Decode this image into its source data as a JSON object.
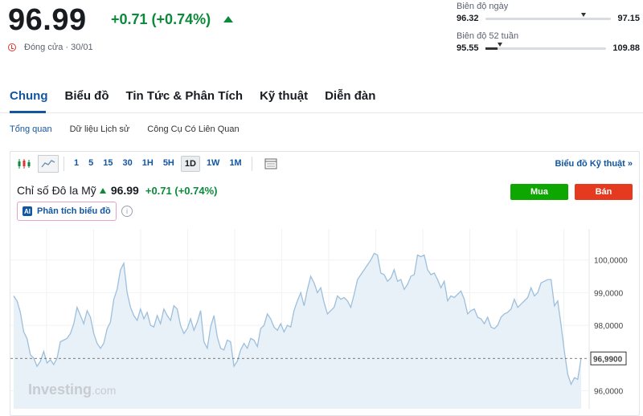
{
  "quote": {
    "price": "96.99",
    "change": "+0.71 (+0.74%)",
    "status": "Đóng cửa · 30/01"
  },
  "day_range": {
    "label": "Biên độ ngày",
    "low": "96.32",
    "high": "97.15",
    "position": 0.76
  },
  "range_52w": {
    "label": "Biên độ 52 tuần",
    "low": "95.55",
    "high": "109.88",
    "position": 0.1
  },
  "tabs": [
    {
      "label": "Chung",
      "active": true
    },
    {
      "label": "Biểu đồ",
      "active": false
    },
    {
      "label": "Tin Tức & Phân Tích",
      "active": false
    },
    {
      "label": "Kỹ thuật",
      "active": false
    },
    {
      "label": "Diễn đàn",
      "active": false
    }
  ],
  "subtabs": [
    {
      "label": "Tổng quan",
      "active": true
    },
    {
      "label": "Dữ liệu Lịch sử",
      "active": false
    },
    {
      "label": "Công Cụ Có Liên Quan",
      "active": false
    }
  ],
  "toolbar": {
    "timeframes": [
      "1",
      "5",
      "15",
      "30",
      "1H",
      "5H",
      "1D",
      "1W",
      "1M"
    ],
    "active_timeframe": "1D",
    "tech_link": "Biểu đồ Kỹ thuật »"
  },
  "chart_header": {
    "name": "Chỉ số Đô la Mỹ",
    "value": "96.99",
    "change": "+0.71 (+0.74%)",
    "ai_label": "Phân tích biểu đồ",
    "ai_badge": "AI",
    "info": "i"
  },
  "trade": {
    "buy": "Mua",
    "sell": "Bán"
  },
  "colors": {
    "up": "#0a8a3a",
    "accent": "#1256a0",
    "buy": "#0ea600",
    "sell": "#e53a20",
    "line": "#9dbfdc",
    "area": "#e8f1f8"
  },
  "watermark": {
    "brand": "Investing",
    "suffix": ".com"
  },
  "chart_data": {
    "type": "area",
    "y_ticks": [
      "100,0000",
      "99,0000",
      "98,0000",
      "96,0000"
    ],
    "y_tick_values": [
      100,
      99,
      98,
      96
    ],
    "current_label": "96,9900",
    "current_value": 96.99,
    "ylim": [
      95.45,
      100.95
    ],
    "values": [
      98.9,
      98.75,
      98.4,
      97.8,
      97.6,
      97.1,
      97.0,
      96.75,
      96.9,
      97.2,
      96.85,
      96.95,
      96.8,
      97.0,
      97.5,
      97.55,
      97.6,
      97.75,
      98.05,
      98.55,
      98.3,
      98.05,
      98.45,
      98.25,
      97.75,
      97.45,
      97.3,
      97.45,
      97.9,
      98.1,
      98.8,
      99.1,
      99.7,
      99.9,
      99.0,
      98.55,
      98.3,
      98.15,
      98.5,
      98.2,
      98.4,
      98.0,
      97.95,
      98.3,
      98.05,
      98.5,
      98.3,
      98.15,
      98.6,
      98.5,
      98.0,
      97.75,
      97.9,
      98.2,
      97.85,
      98.1,
      98.45,
      97.5,
      97.3,
      97.95,
      98.3,
      97.65,
      97.3,
      97.25,
      97.55,
      97.5,
      96.75,
      96.9,
      97.25,
      97.45,
      97.3,
      97.6,
      97.55,
      97.35,
      97.9,
      98.0,
      98.35,
      98.2,
      97.95,
      97.85,
      98.05,
      97.8,
      98.0,
      97.95,
      98.45,
      98.75,
      99.0,
      98.6,
      99.1,
      99.5,
      99.3,
      99.0,
      99.15,
      98.7,
      98.35,
      98.45,
      98.55,
      98.9,
      98.8,
      98.85,
      98.75,
      98.55,
      98.95,
      99.4,
      99.55,
      99.7,
      99.85,
      100.0,
      100.2,
      100.15,
      99.6,
      99.55,
      99.35,
      99.45,
      99.7,
      99.35,
      99.4,
      99.1,
      99.25,
      99.5,
      99.55,
      100.15,
      100.1,
      100.15,
      99.7,
      99.55,
      99.6,
      99.4,
      99.15,
      99.35,
      98.75,
      98.9,
      98.85,
      98.95,
      99.05,
      98.8,
      98.35,
      98.45,
      98.5,
      98.25,
      98.2,
      98.05,
      98.25,
      97.95,
      97.9,
      98.0,
      98.25,
      98.35,
      98.4,
      98.5,
      98.8,
      98.55,
      98.65,
      98.75,
      98.85,
      99.15,
      98.9,
      99.0,
      99.3,
      99.35,
      99.4,
      99.4,
      98.6,
      98.75,
      98.0,
      97.2,
      96.5,
      96.2,
      96.4,
      96.35,
      96.99
    ]
  }
}
